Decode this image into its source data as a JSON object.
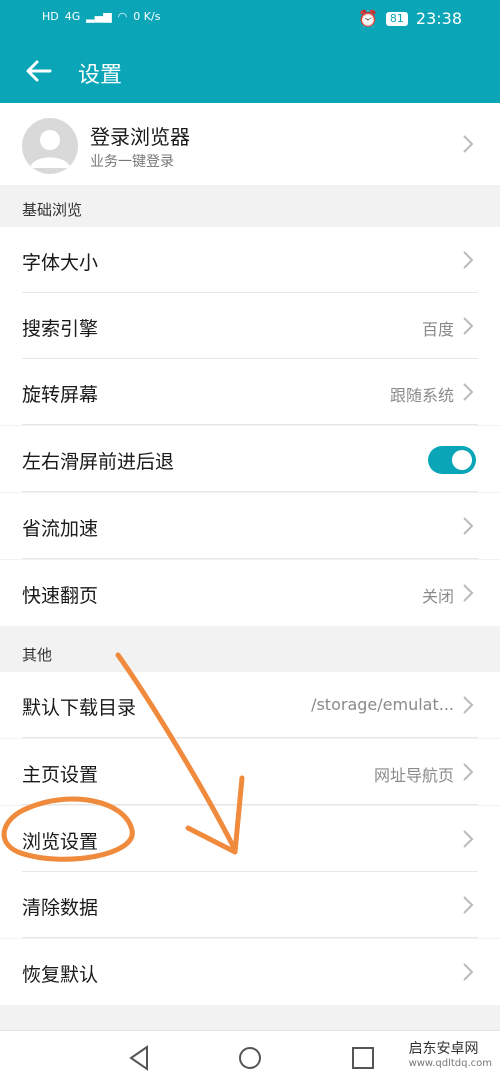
{
  "status_bar": {
    "carrier": "HD",
    "network": "4G",
    "speed": "0 K/s",
    "battery": "81",
    "time": "23:38"
  },
  "header": {
    "title": "设置"
  },
  "account": {
    "title": "登录浏览器",
    "subtitle": "业务一键登录"
  },
  "sections": [
    {
      "title": "基础浏览",
      "items": [
        {
          "label": "字体大小",
          "value": ""
        },
        {
          "label": "搜索引擎",
          "value": "百度"
        },
        {
          "label": "旋转屏幕",
          "value": "跟随系统"
        },
        {
          "label": "左右滑屏前进后退",
          "toggle": true
        },
        {
          "label": "省流加速",
          "value": ""
        },
        {
          "label": "快速翻页",
          "value": "关闭"
        }
      ]
    },
    {
      "title": "其他",
      "items": [
        {
          "label": "默认下载目录",
          "value": "/storage/emulat..."
        },
        {
          "label": "主页设置",
          "value": "网址导航页"
        },
        {
          "label": "浏览设置",
          "value": ""
        },
        {
          "label": "清除数据",
          "value": ""
        },
        {
          "label": "恢复默认",
          "value": ""
        }
      ]
    }
  ],
  "watermark": {
    "name": "启东安卓网",
    "url": "www.qdltdq.com"
  },
  "colors": {
    "accent": "#0aa6b8",
    "annotation": "#f08a3c"
  }
}
